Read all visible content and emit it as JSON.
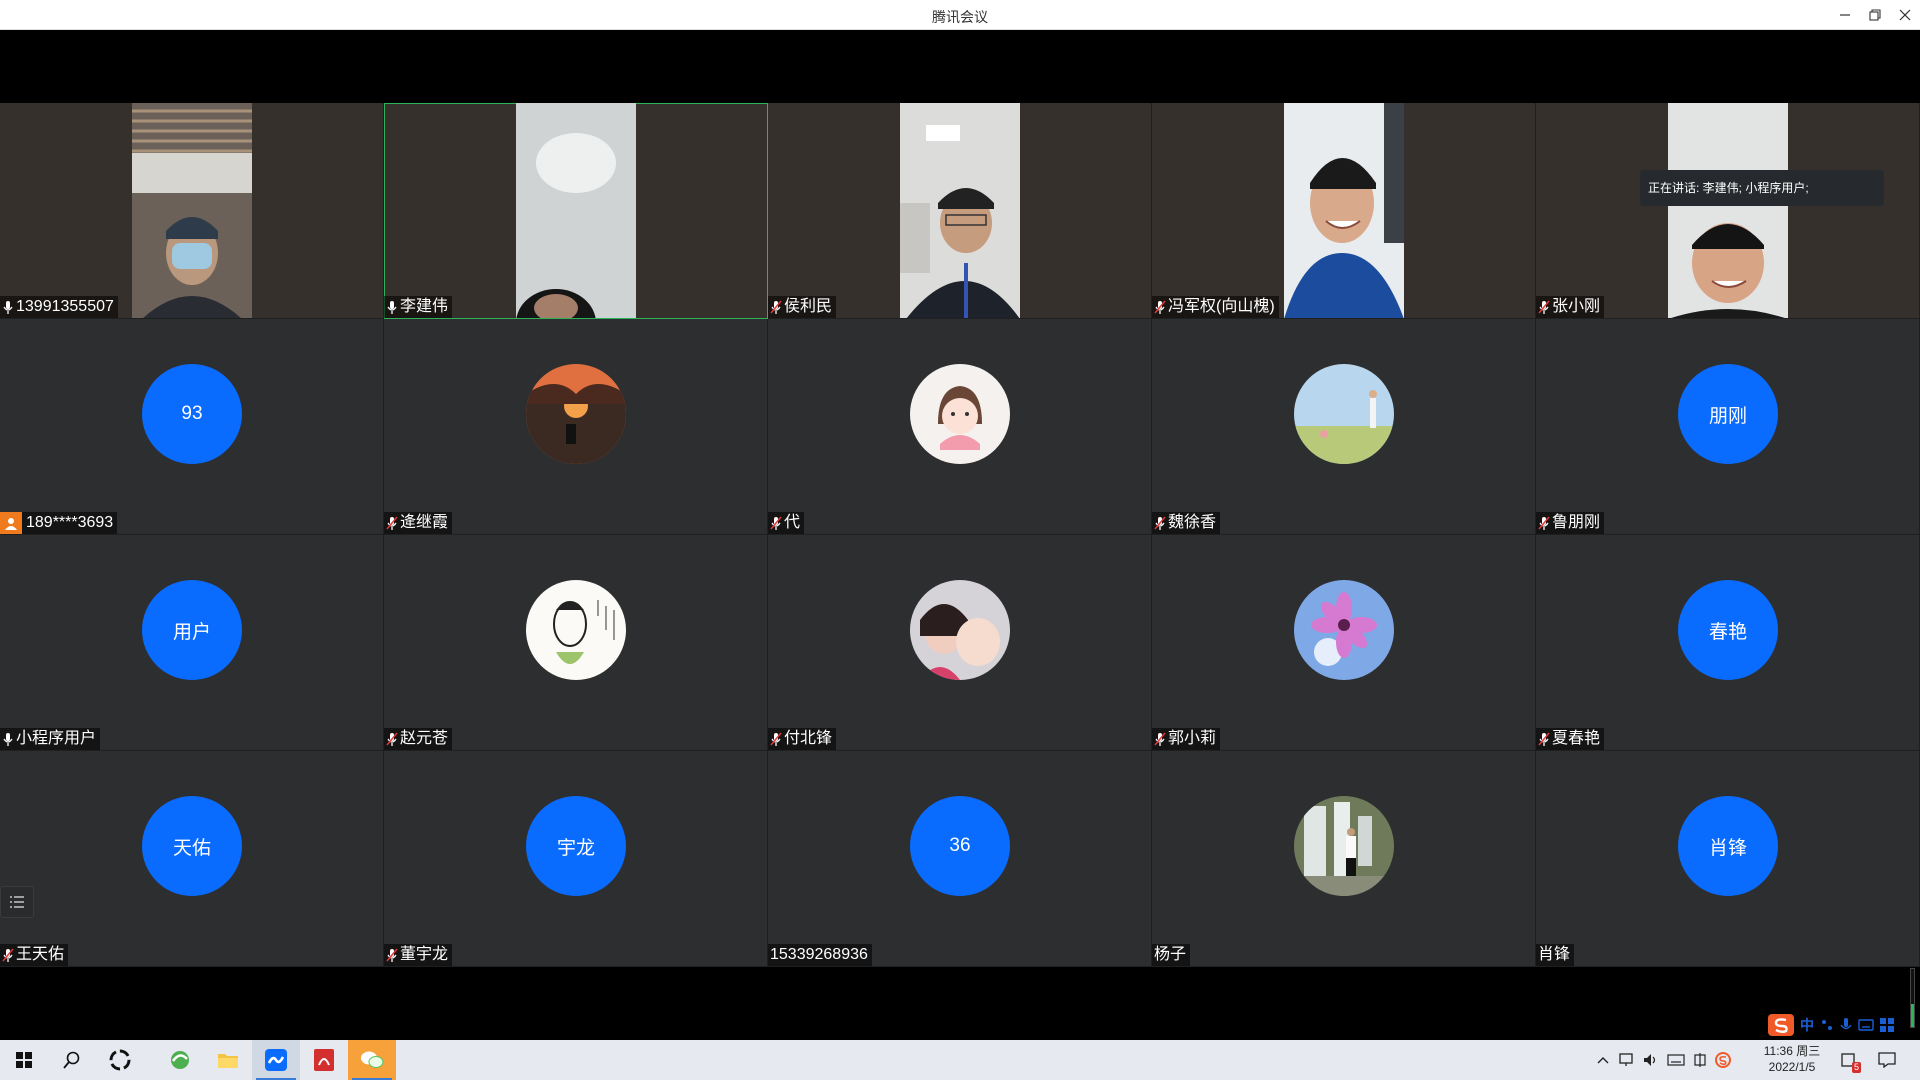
{
  "window": {
    "title": "腾讯会议"
  },
  "speaking": {
    "text": "正在讲话: 李建伟; 小程序用户;"
  },
  "tiles": [
    {
      "kind": "video",
      "name": "13991355507",
      "mic": "on"
    },
    {
      "kind": "video",
      "name": "李建伟",
      "mic": "on",
      "active": true
    },
    {
      "kind": "video",
      "name": "侯利民",
      "mic": "muted"
    },
    {
      "kind": "video",
      "name": "冯军权(向山槐)",
      "mic": "muted"
    },
    {
      "kind": "video",
      "name": "张小刚",
      "mic": "muted"
    },
    {
      "kind": "initials",
      "initials": "93",
      "name": "189****3693",
      "mic": "phone"
    },
    {
      "kind": "photo",
      "name": "逄继霞",
      "mic": "muted",
      "photo": "sunset-photo"
    },
    {
      "kind": "photo",
      "name": "代",
      "mic": "muted",
      "photo": "cartoon-girl-photo"
    },
    {
      "kind": "photo",
      "name": "魏徐香",
      "mic": "muted",
      "photo": "field-photo"
    },
    {
      "kind": "initials",
      "initials": "朋刚",
      "name": "鲁朋刚",
      "mic": "muted"
    },
    {
      "kind": "initials",
      "initials": "用户",
      "name": "小程序用户",
      "mic": "on"
    },
    {
      "kind": "photo",
      "name": "赵元苍",
      "mic": "muted",
      "photo": "sketch-portrait-photo"
    },
    {
      "kind": "photo",
      "name": "付北锋",
      "mic": "muted",
      "photo": "selfie-photo"
    },
    {
      "kind": "photo",
      "name": "郭小莉",
      "mic": "muted",
      "photo": "flower-photo"
    },
    {
      "kind": "initials",
      "initials": "春艳",
      "name": "夏春艳",
      "mic": "muted"
    },
    {
      "kind": "initials",
      "initials": "天佑",
      "name": "王天佑",
      "mic": "muted"
    },
    {
      "kind": "initials",
      "initials": "宇龙",
      "name": "董宇龙",
      "mic": "muted"
    },
    {
      "kind": "initials",
      "initials": "36",
      "name": "15339268936",
      "mic": "none"
    },
    {
      "kind": "photo",
      "name": "杨子",
      "mic": "none",
      "photo": "waterfall-photo"
    },
    {
      "kind": "initials",
      "initials": "肖锋",
      "name": "肖锋",
      "mic": "none"
    }
  ],
  "taskbar": {
    "clock_time": "11:36 周三",
    "clock_date": "2022/1/5",
    "ime_lang": "中",
    "tray_notification_count": "5"
  },
  "colors": {
    "accent_blue": "#0a6cff",
    "active_border": "#2bb45a",
    "tile_bg": "#2d2e30"
  }
}
